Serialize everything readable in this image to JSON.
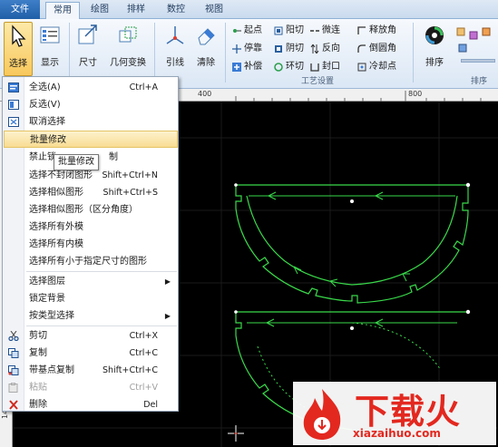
{
  "tabs": [
    "文件",
    "常用",
    "绘图",
    "排样",
    "数控",
    "视图"
  ],
  "ribbon": {
    "big_buttons": [
      "选择",
      "显示",
      "尺寸",
      "几何变换",
      "引线",
      "清除",
      "排序"
    ],
    "process_group_label": "工艺设置",
    "sort_group_label": "排序",
    "small_buttons": [
      "起点",
      "阳切",
      "微连",
      "释放角",
      "停靠",
      "阴切",
      "反向",
      "倒圆角",
      "补偿",
      "环切",
      "封口",
      "冷却点"
    ]
  },
  "ruler": {
    "top_marks": [
      "400",
      "800"
    ],
    "left_mark": "1400"
  },
  "menu": {
    "items": [
      {
        "label": "全选(A)",
        "shortcut": "Ctrl+A",
        "icon": "select-all-icon"
      },
      {
        "label": "反选(V)",
        "shortcut": "",
        "icon": "invert-selection-icon"
      },
      {
        "label": "取消选择",
        "shortcut": "",
        "icon": "deselect-icon"
      },
      {
        "label": "批量修改",
        "shortcut": ""
      },
      {
        "label": "禁止锁",
        "shortcut": "",
        "suffix": "制"
      },
      {
        "label": "选择不封闭图形",
        "shortcut": "Shift+Ctrl+N"
      },
      {
        "label": "选择相似图形",
        "shortcut": "Shift+Ctrl+S"
      },
      {
        "label": "选择相似图形（区分角度）",
        "shortcut": ""
      },
      {
        "label": "选择所有外模",
        "shortcut": ""
      },
      {
        "label": "选择所有内模",
        "shortcut": ""
      },
      {
        "label": "选择所有小于指定尺寸的图形",
        "shortcut": ""
      },
      {
        "label": "选择图层",
        "shortcut": "",
        "submenu": true
      },
      {
        "label": "锁定背景",
        "shortcut": ""
      },
      {
        "label": "按类型选择",
        "shortcut": "",
        "submenu": true
      },
      {
        "label": "剪切",
        "shortcut": "Ctrl+X",
        "icon": "scissors-icon"
      },
      {
        "label": "复制",
        "shortcut": "Ctrl+C",
        "icon": "copy-icon"
      },
      {
        "label": "带基点复制",
        "shortcut": "Shift+Ctrl+C",
        "icon": "copy-with-basepoint-icon"
      },
      {
        "label": "粘贴",
        "shortcut": "Ctrl+V",
        "icon": "paste-icon",
        "disabled": true
      },
      {
        "label": "删除",
        "shortcut": "Del",
        "icon": "delete-icon"
      }
    ]
  },
  "tooltip": "批量修改",
  "watermark": {
    "brand": "下载火",
    "url": "xiazaihuo.com"
  },
  "colors": {
    "accent": "#1f5fa8",
    "shape": "#39d94a",
    "highlight": "#f8dc92",
    "watermark": "#e3281f"
  }
}
